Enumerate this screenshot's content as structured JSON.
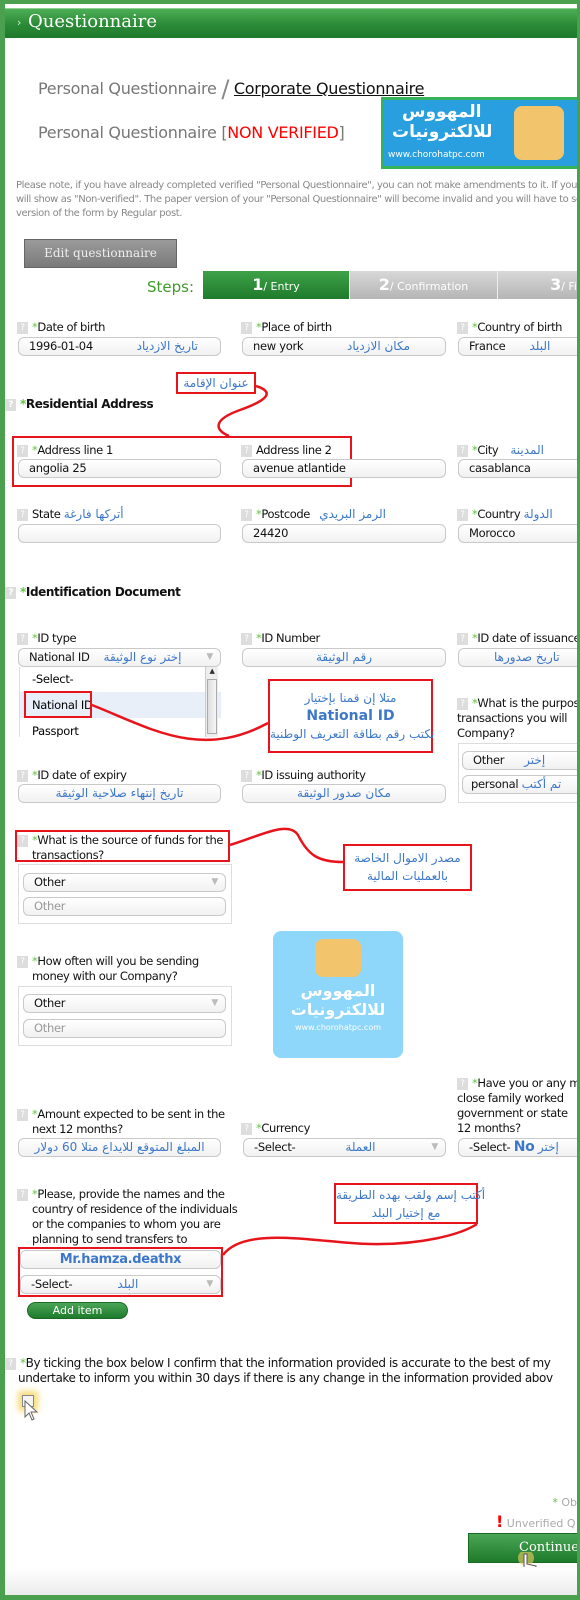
{
  "header": {
    "title": "Questionnaire"
  },
  "nav": {
    "personal": "Personal Questionnaire",
    "separator": "/",
    "corporate": "Corporate Questionnaire"
  },
  "status": {
    "title": "Personal Questionnaire",
    "open": "[",
    "badge": "NON VERIFIED",
    "close": "]"
  },
  "logo": {
    "line1": "المهووس",
    "line2": "للالكترونيات",
    "url": "www.chorohatpc.com"
  },
  "notice": [
    "Please note, if you have already completed verified \"Personal Questionnaire\", you can not make amendments to it. If you d",
    "will show as \"Non-verified\". The paper version of your \"Personal Questionnaire\" will become invalid and you will have to send",
    "version of the form by Regular post."
  ],
  "edit_button": "Edit questionnaire",
  "steps": {
    "label": "Steps:",
    "items": [
      {
        "num": "1",
        "label": "/ Entry"
      },
      {
        "num": "2",
        "label": "/ Confirmation"
      },
      {
        "num": "3",
        "label": "/ Fi"
      }
    ]
  },
  "help": "?",
  "star": "*",
  "f": {
    "dob": {
      "label": "Date of birth",
      "value": "1996-01-04",
      "hint": "تاريخ الازدياد"
    },
    "pob": {
      "label": "Place of birth",
      "value": "new york",
      "hint": "مكان الازدياد"
    },
    "cob": {
      "label": "Country of birth",
      "value": "France",
      "hint": "البلد"
    },
    "res": {
      "label": "Residential Address"
    },
    "addr1": {
      "label": "Address line 1",
      "value": "angolia 25"
    },
    "addr2": {
      "label": "Address line 2",
      "value": "avenue atlantide"
    },
    "city": {
      "label": "City",
      "value": "casablanca",
      "hint": "المدينة"
    },
    "state": {
      "label": "State",
      "value": "",
      "hint": "أتركها فارغة"
    },
    "postcode": {
      "label": "Postcode",
      "value": "24420",
      "hint": "الرمز البريدي"
    },
    "country": {
      "label": "Country",
      "value": "Morocco",
      "hint": "الدولة"
    },
    "iddoc": {
      "label": "Identification Document"
    },
    "idtype": {
      "label": "ID type",
      "value": "National ID",
      "hint": "إختر نوع الوثيقة",
      "options": [
        "-Select-",
        "National ID",
        "Passport"
      ]
    },
    "idnum": {
      "label": "ID Number",
      "hint": "رقم الوثيقة"
    },
    "idiss": {
      "label": "ID date of issuance",
      "hint": "تاريخ صدورها"
    },
    "purpose": {
      "label": [
        "What is the purpos",
        "transactions you will",
        "Company?"
      ],
      "select": "Other",
      "select_hint": "إختر",
      "input": "personal",
      "input_hint": "تم أكتب"
    },
    "idexp": {
      "label": "ID date of expiry",
      "hint": "تاريخ إنتهاء صلاحية الوثيقة"
    },
    "idauth": {
      "label": "ID issuing authority",
      "hint": "مكان صدور الوثيقة"
    },
    "funds": {
      "label": [
        "What is the source of funds for the",
        "transactions?"
      ],
      "select": "Other",
      "placeholder": "Other"
    },
    "often": {
      "label": [
        "How often will you be sending",
        "money with our Company?"
      ],
      "select": "Other",
      "placeholder": "Other"
    },
    "amount": {
      "label": [
        "Amount expected to be sent in the",
        "next 12 months?"
      ],
      "hint": "المبلغ المتوقع للايداع متلا 60 دولار"
    },
    "currency": {
      "label": "Currency",
      "value": "-Select-",
      "hint": "العملة"
    },
    "pep": {
      "label": [
        "Have you or any m",
        "close family worked",
        "government or state",
        "12 months?"
      ],
      "value": "-Select-",
      "answer": "No",
      "hint": "إختر"
    },
    "recip": {
      "label": [
        "Please, provide the names and the",
        "country of residence of the individuals",
        "or the companies to whom you are",
        "planning to send transfers to"
      ],
      "name": "Mr.hamza.deathx",
      "country": "-Select-",
      "country_hint": "البلد"
    }
  },
  "add_item": "Add item",
  "confirm": [
    "By ticking the box below I confirm that the information provided is accurate to the best of my",
    "undertake to inform you within 30 days if there is any change in the information provided abov"
  ],
  "annotations": {
    "res": "عنوان الإقامة",
    "id": [
      "متلا إن قمنا بإختيار",
      "National ID",
      "نكتب رقم بطاقة التعريف الوطنية"
    ],
    "funds": [
      "مصدر الاموال الخاصة",
      "بالعمليات المالية"
    ],
    "recip": [
      "أكتب إسم ولقب بهده الطريقة",
      "مع إختيار البلد"
    ]
  },
  "legend": {
    "star": "*",
    "obligatory": "Ob",
    "excl": "!",
    "unverified": "Unverified Q"
  },
  "continue": "Continue",
  "colors": {
    "brand_green": "#2a8a36",
    "annotation_red": "#e8141b",
    "annotation_blue": "#3d78c8",
    "error_red": "#ff0000"
  }
}
